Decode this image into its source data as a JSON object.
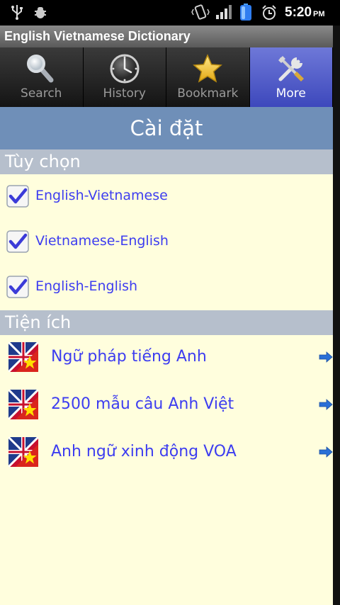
{
  "status_bar": {
    "time": "5:20",
    "ampm": "PM",
    "icons": [
      "usb-icon",
      "debug-bug-icon",
      "vibrate-icon",
      "signal-icon",
      "battery-icon",
      "alarm-icon"
    ]
  },
  "app": {
    "title": "English Vietnamese Dictionary"
  },
  "tabs": [
    {
      "label": "Search",
      "icon": "magnifier-icon"
    },
    {
      "label": "History",
      "icon": "clock-icon"
    },
    {
      "label": "Bookmark",
      "icon": "star-icon"
    },
    {
      "label": "More",
      "icon": "tools-icon",
      "active": true
    }
  ],
  "page": {
    "title": "Cài đặt"
  },
  "options": {
    "header": "Tùy chọn",
    "items": [
      {
        "label": "English-Vietnamese",
        "checked": true
      },
      {
        "label": "Vietnamese-English",
        "checked": true
      },
      {
        "label": "English-English",
        "checked": true
      }
    ]
  },
  "utilities": {
    "header": "Tiện ích",
    "items": [
      {
        "label": "Ngữ pháp tiếng Anh",
        "icon": "uk-vn-flag-icon"
      },
      {
        "label": "2500 mẫu câu Anh Việt",
        "icon": "uk-vn-flag-icon"
      },
      {
        "label": "Anh ngữ xinh động VOA",
        "icon": "uk-vn-flag-icon"
      }
    ]
  },
  "colors": {
    "title_bar": "#707070",
    "active_tab": "#4f5ac8",
    "page_header": "#6f8fb8",
    "section_header": "#b6bfcc",
    "content_bg": "#fffedd",
    "link_text": "#3d3df0"
  }
}
